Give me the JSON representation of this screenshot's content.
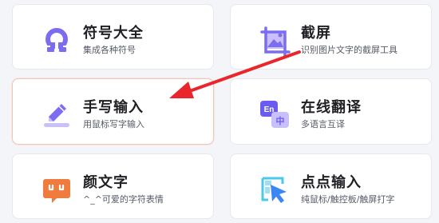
{
  "cards": [
    {
      "title": "符号大全",
      "desc": "集成各种符号",
      "icon": "omega-icon"
    },
    {
      "title": "截屏",
      "desc": "识别图片文字的截屏工具",
      "icon": "screenshot-icon"
    },
    {
      "title": "手写输入",
      "desc": "用鼠标写字输入",
      "icon": "pen-icon",
      "highlighted": true
    },
    {
      "title": "在线翻译",
      "desc": "多语言互译",
      "icon": "translate-icon",
      "badge_en": "En",
      "badge_zh": "中"
    },
    {
      "title": "颜文字",
      "desc": "^_^可爱的字符表情",
      "icon": "emoticon-icon",
      "icon_text": "ᵔᵕᵔ"
    },
    {
      "title": "点点输入",
      "desc": "纯鼠标/触控板/触屏打字",
      "icon": "cursor-click-icon"
    }
  ],
  "annotation": {
    "type": "red-arrow",
    "color": "#e8262c",
    "points_to": "手写输入"
  },
  "colors": {
    "purple": "#7b6cf2",
    "purple_light": "#c9bffb",
    "orange": "#f07b3f",
    "blue": "#3a86f4",
    "cyan": "#4cc8e8"
  }
}
